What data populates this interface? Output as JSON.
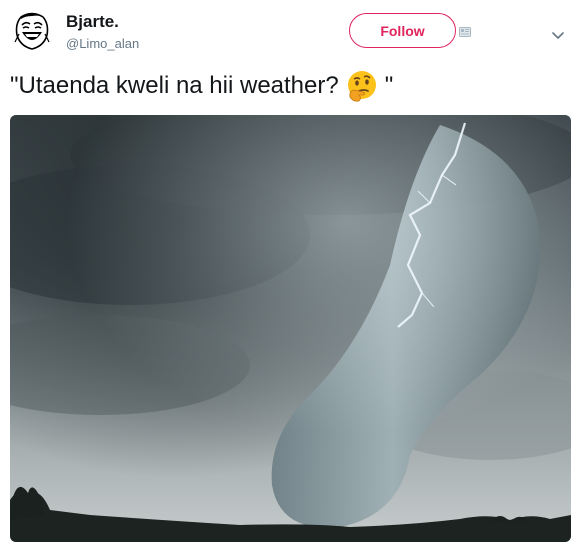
{
  "author": {
    "display_name": "Bjarte.",
    "handle": "@Limo_alan"
  },
  "follow_button": {
    "label": "Follow",
    "color": "#e0245e"
  },
  "tweet": {
    "text_before_emoji": "\"Utaenda kweli na hii weather?",
    "emoji": "thinking-face-icon",
    "text_after_emoji": "\""
  },
  "colors": {
    "name": "#14171a",
    "secondary": "#657786"
  }
}
